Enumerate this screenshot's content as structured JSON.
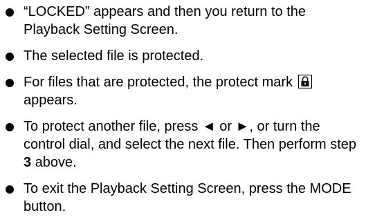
{
  "items": [
    {
      "lines": [
        "“LOCKED” appears and then you return to the",
        "Playback Setting Screen."
      ]
    },
    {
      "lines": [
        "The selected file is protected."
      ]
    },
    {
      "line1_text": "For files that are protected, the protect mark",
      "line2": "appears."
    },
    {
      "line1": "To protect another file, press ◄ or ►, or turn the",
      "line2": "control dial, and select the next file. Then perform step",
      "step_number": "3",
      "line3_suffix": " above."
    },
    {
      "lines": [
        "To exit the Playback Setting Screen, press the MODE",
        "button."
      ]
    }
  ],
  "icons": {
    "protect_mark": "lock-icon"
  }
}
